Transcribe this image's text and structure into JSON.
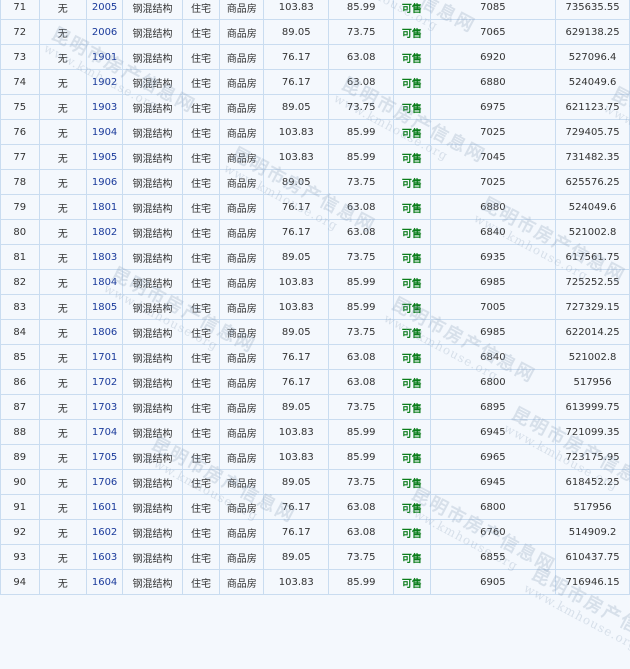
{
  "rows": [
    {
      "idx": "71",
      "none": "无",
      "room": "2005",
      "struct": "钢混结构",
      "use": "住宅",
      "type": "商品房",
      "area": "103.83",
      "inner": "85.99",
      "status": "可售",
      "price": "7085",
      "total": "735635.55"
    },
    {
      "idx": "72",
      "none": "无",
      "room": "2006",
      "struct": "钢混结构",
      "use": "住宅",
      "type": "商品房",
      "area": "89.05",
      "inner": "73.75",
      "status": "可售",
      "price": "7065",
      "total": "629138.25"
    },
    {
      "idx": "73",
      "none": "无",
      "room": "1901",
      "struct": "钢混结构",
      "use": "住宅",
      "type": "商品房",
      "area": "76.17",
      "inner": "63.08",
      "status": "可售",
      "price": "6920",
      "total": "527096.4"
    },
    {
      "idx": "74",
      "none": "无",
      "room": "1902",
      "struct": "钢混结构",
      "use": "住宅",
      "type": "商品房",
      "area": "76.17",
      "inner": "63.08",
      "status": "可售",
      "price": "6880",
      "total": "524049.6"
    },
    {
      "idx": "75",
      "none": "无",
      "room": "1903",
      "struct": "钢混结构",
      "use": "住宅",
      "type": "商品房",
      "area": "89.05",
      "inner": "73.75",
      "status": "可售",
      "price": "6975",
      "total": "621123.75"
    },
    {
      "idx": "76",
      "none": "无",
      "room": "1904",
      "struct": "钢混结构",
      "use": "住宅",
      "type": "商品房",
      "area": "103.83",
      "inner": "85.99",
      "status": "可售",
      "price": "7025",
      "total": "729405.75"
    },
    {
      "idx": "77",
      "none": "无",
      "room": "1905",
      "struct": "钢混结构",
      "use": "住宅",
      "type": "商品房",
      "area": "103.83",
      "inner": "85.99",
      "status": "可售",
      "price": "7045",
      "total": "731482.35"
    },
    {
      "idx": "78",
      "none": "无",
      "room": "1906",
      "struct": "钢混结构",
      "use": "住宅",
      "type": "商品房",
      "area": "89.05",
      "inner": "73.75",
      "status": "可售",
      "price": "7025",
      "total": "625576.25"
    },
    {
      "idx": "79",
      "none": "无",
      "room": "1801",
      "struct": "钢混结构",
      "use": "住宅",
      "type": "商品房",
      "area": "76.17",
      "inner": "63.08",
      "status": "可售",
      "price": "6880",
      "total": "524049.6"
    },
    {
      "idx": "80",
      "none": "无",
      "room": "1802",
      "struct": "钢混结构",
      "use": "住宅",
      "type": "商品房",
      "area": "76.17",
      "inner": "63.08",
      "status": "可售",
      "price": "6840",
      "total": "521002.8"
    },
    {
      "idx": "81",
      "none": "无",
      "room": "1803",
      "struct": "钢混结构",
      "use": "住宅",
      "type": "商品房",
      "area": "89.05",
      "inner": "73.75",
      "status": "可售",
      "price": "6935",
      "total": "617561.75"
    },
    {
      "idx": "82",
      "none": "无",
      "room": "1804",
      "struct": "钢混结构",
      "use": "住宅",
      "type": "商品房",
      "area": "103.83",
      "inner": "85.99",
      "status": "可售",
      "price": "6985",
      "total": "725252.55"
    },
    {
      "idx": "83",
      "none": "无",
      "room": "1805",
      "struct": "钢混结构",
      "use": "住宅",
      "type": "商品房",
      "area": "103.83",
      "inner": "85.99",
      "status": "可售",
      "price": "7005",
      "total": "727329.15"
    },
    {
      "idx": "84",
      "none": "无",
      "room": "1806",
      "struct": "钢混结构",
      "use": "住宅",
      "type": "商品房",
      "area": "89.05",
      "inner": "73.75",
      "status": "可售",
      "price": "6985",
      "total": "622014.25"
    },
    {
      "idx": "85",
      "none": "无",
      "room": "1701",
      "struct": "钢混结构",
      "use": "住宅",
      "type": "商品房",
      "area": "76.17",
      "inner": "63.08",
      "status": "可售",
      "price": "6840",
      "total": "521002.8"
    },
    {
      "idx": "86",
      "none": "无",
      "room": "1702",
      "struct": "钢混结构",
      "use": "住宅",
      "type": "商品房",
      "area": "76.17",
      "inner": "63.08",
      "status": "可售",
      "price": "6800",
      "total": "517956"
    },
    {
      "idx": "87",
      "none": "无",
      "room": "1703",
      "struct": "钢混结构",
      "use": "住宅",
      "type": "商品房",
      "area": "89.05",
      "inner": "73.75",
      "status": "可售",
      "price": "6895",
      "total": "613999.75"
    },
    {
      "idx": "88",
      "none": "无",
      "room": "1704",
      "struct": "钢混结构",
      "use": "住宅",
      "type": "商品房",
      "area": "103.83",
      "inner": "85.99",
      "status": "可售",
      "price": "6945",
      "total": "721099.35"
    },
    {
      "idx": "89",
      "none": "无",
      "room": "1705",
      "struct": "钢混结构",
      "use": "住宅",
      "type": "商品房",
      "area": "103.83",
      "inner": "85.99",
      "status": "可售",
      "price": "6965",
      "total": "723175.95"
    },
    {
      "idx": "90",
      "none": "无",
      "room": "1706",
      "struct": "钢混结构",
      "use": "住宅",
      "type": "商品房",
      "area": "89.05",
      "inner": "73.75",
      "status": "可售",
      "price": "6945",
      "total": "618452.25"
    },
    {
      "idx": "91",
      "none": "无",
      "room": "1601",
      "struct": "钢混结构",
      "use": "住宅",
      "type": "商品房",
      "area": "76.17",
      "inner": "63.08",
      "status": "可售",
      "price": "6800",
      "total": "517956"
    },
    {
      "idx": "92",
      "none": "无",
      "room": "1602",
      "struct": "钢混结构",
      "use": "住宅",
      "type": "商品房",
      "area": "76.17",
      "inner": "63.08",
      "status": "可售",
      "price": "6760",
      "total": "514909.2"
    },
    {
      "idx": "93",
      "none": "无",
      "room": "1603",
      "struct": "钢混结构",
      "use": "住宅",
      "type": "商品房",
      "area": "89.05",
      "inner": "73.75",
      "status": "可售",
      "price": "6855",
      "total": "610437.75"
    },
    {
      "idx": "94",
      "none": "无",
      "room": "1604",
      "struct": "钢混结构",
      "use": "住宅",
      "type": "商品房",
      "area": "103.83",
      "inner": "85.99",
      "status": "可售",
      "price": "6905",
      "total": "716946.15"
    }
  ],
  "watermark": {
    "cn": "昆明市房产信息网",
    "url": "www.kmhouse.org"
  }
}
